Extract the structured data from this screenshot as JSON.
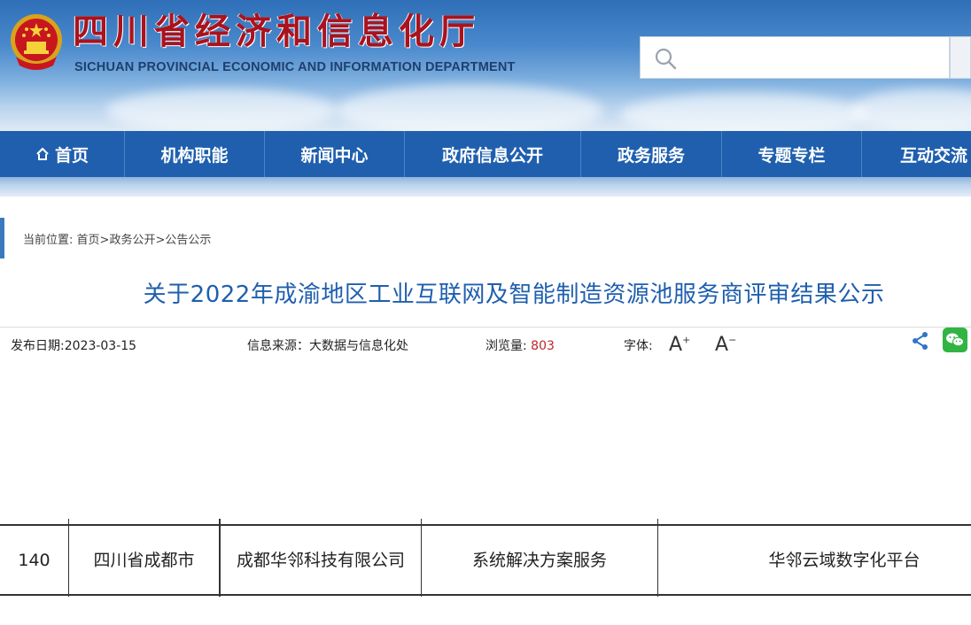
{
  "header": {
    "title": "四川省经济和信息化厅",
    "subtitle": "SICHUAN PROVINCIAL ECONOMIC AND INFORMATION DEPARTMENT",
    "emblem_icon": "national-emblem-icon",
    "search_placeholder": "",
    "colors": {
      "title": "#a9131e",
      "nav": "#1f5fae"
    }
  },
  "nav": {
    "items": [
      {
        "label": "首页",
        "icon": "home-icon"
      },
      {
        "label": "机构职能"
      },
      {
        "label": "新闻中心"
      },
      {
        "label": "政府信息公开"
      },
      {
        "label": "政务服务"
      },
      {
        "label": "专题专栏"
      },
      {
        "label": "互动交流"
      }
    ]
  },
  "breadcrumb": {
    "prefix": "当前位置:",
    "items": [
      "首页",
      "政务公开",
      "公告公示"
    ],
    "separator": ">"
  },
  "article": {
    "title": "关于2022年成渝地区工业互联网及智能制造资源池服务商评审结果公示",
    "date_label": "发布日期:",
    "date_value": "2023-03-15",
    "source_label": "信息来源：",
    "source_value": "大数据与信息化处",
    "views_label": "浏览量:",
    "views_value": "803",
    "font_label": "字体:",
    "font_increase": "A",
    "font_decrease": "A",
    "share_icon": "share-icon",
    "wechat_icon": "wechat-icon"
  },
  "table": {
    "row": {
      "number": "140",
      "region": "四川省成都市",
      "company": "成都华邻科技有限公司",
      "service": "系统解决方案服务",
      "platform": "华邻云域数字化平台"
    }
  }
}
